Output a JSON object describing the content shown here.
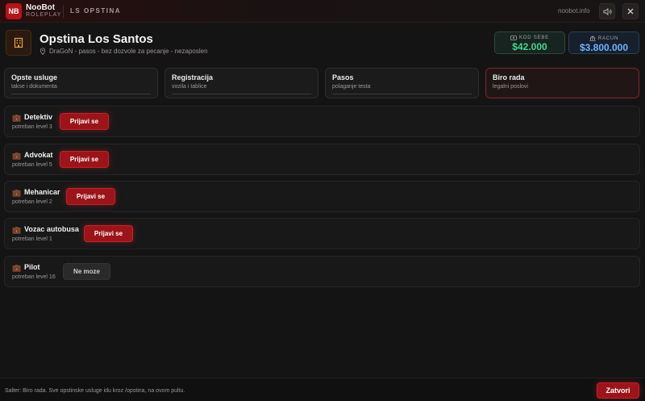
{
  "topbar": {
    "logo": "NB",
    "brand_name": "NooBot",
    "brand_sub": "ROLEPLAY",
    "section": "LS OPSTINA",
    "site": "noobot.info",
    "sound_icon": "speaker-icon",
    "close_icon": "close-icon"
  },
  "header": {
    "icon": "building-icon",
    "title": "Opstina Los Santos",
    "subtitle": "DraGoN - pasos - bez dozvole za pecanje - nezaposlen",
    "location_icon": "map-pin-icon"
  },
  "money": {
    "cash_label": "KOD SEBE",
    "cash_value": "$42.000",
    "bank_label": "RACUN",
    "bank_value": "$3.800.000",
    "colors": {
      "cash": "#46d68f",
      "bank": "#6fb2ff"
    }
  },
  "tabs": [
    {
      "title": "Opste usluge",
      "sub": "takse i dokumenta"
    },
    {
      "title": "Registracija",
      "sub": "vozila i tablice"
    },
    {
      "title": "Pasos",
      "sub": "polaganje testa"
    },
    {
      "title": "Biro rada",
      "sub": "legalni poslovi"
    }
  ],
  "jobs": [
    {
      "name": "Detektiv",
      "req": "potreban level 3",
      "action": "Prijavi se"
    },
    {
      "name": "Advokat",
      "req": "potreban level 5",
      "action": "Prijavi se"
    },
    {
      "name": "Mehanicar",
      "req": "potreban level 2",
      "action": "Prijavi se"
    },
    {
      "name": "Vozac autobusa",
      "req": "potreban level 1",
      "action": "Prijavi se"
    },
    {
      "name": "Pilot",
      "req": "potreban level 16",
      "action": "Ne moze"
    }
  ],
  "footer": {
    "text": "Salter: Biro rada. Sve opstinske usluge idu kroz /opstina, na ovom pultu.",
    "close_label": "Zatvori"
  },
  "accent": "#b3151b"
}
